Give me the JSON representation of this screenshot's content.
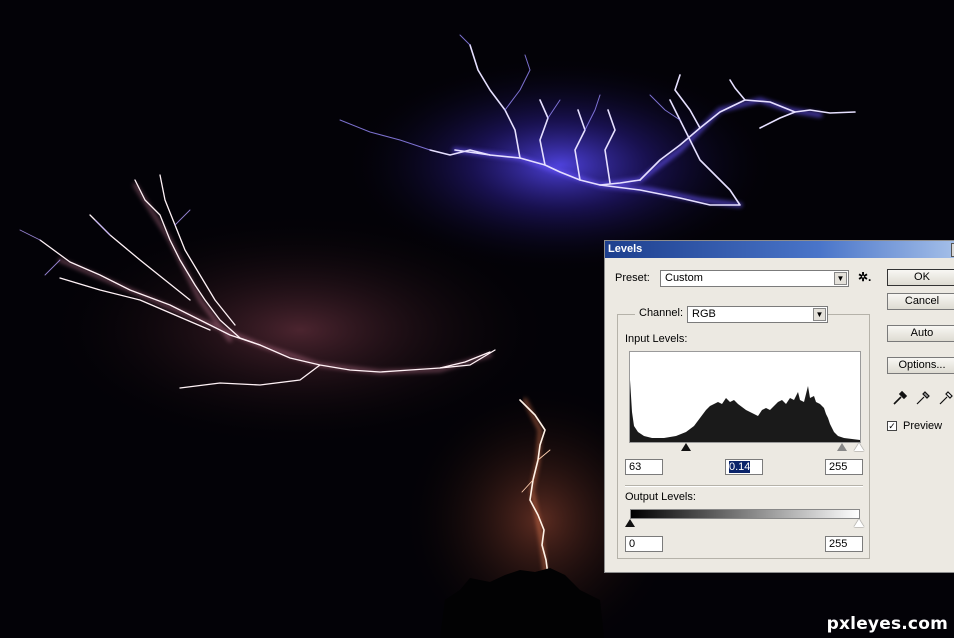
{
  "watermark": "pxleyes.com",
  "dialog": {
    "title": "Levels",
    "preset_label": "Preset:",
    "preset_value": "Custom",
    "channel_label": "Channel:",
    "channel_value": "RGB",
    "input_levels_label": "Input Levels:",
    "input_levels": {
      "black": "63",
      "gamma": "0.14",
      "white": "255"
    },
    "output_levels_label": "Output Levels:",
    "output_levels": {
      "black": "0",
      "white": "255"
    },
    "buttons": {
      "ok": "OK",
      "cancel": "Cancel",
      "auto": "Auto",
      "options": "Options..."
    },
    "preview_label": "Preview",
    "preview_checked": true,
    "close_glyph": "x",
    "gear_glyph": "✲.",
    "dropdown_glyph": "▼",
    "check_glyph": "✓"
  },
  "icons": [
    "gear-icon",
    "close-icon",
    "black-eyedropper-icon",
    "gray-eyedropper-icon",
    "white-eyedropper-icon"
  ],
  "colors": {
    "title_bar": "#2a56b0",
    "dialog_bg": "#ece9e2",
    "lightning_blue": "#6b56ff",
    "lightning_pink": "#ffb8c8"
  }
}
